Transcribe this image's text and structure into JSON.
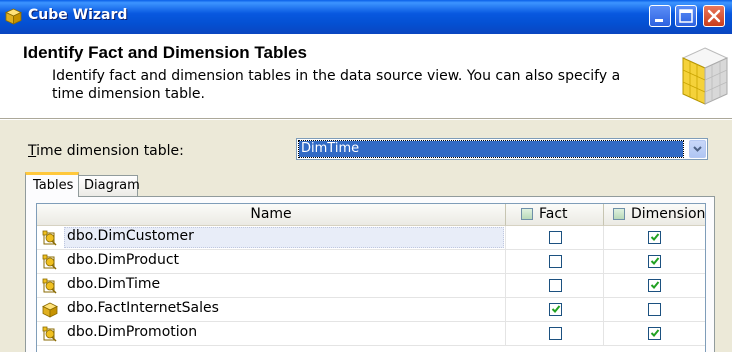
{
  "window": {
    "title": "Cube Wizard"
  },
  "header": {
    "title": "Identify Fact and Dimension Tables",
    "description": "Identify fact and dimension tables in the data source view. You can also specify a time dimension table."
  },
  "time_dimension": {
    "label_prefix": "T",
    "label_rest": "ime dimension table:",
    "selected": "DimTime"
  },
  "tabs": [
    {
      "label": "Tables",
      "active": true
    },
    {
      "label": "Diagram",
      "active": false
    }
  ],
  "grid": {
    "columns": {
      "name": "Name",
      "fact": "Fact",
      "dimension": "Dimension"
    },
    "rows": [
      {
        "name": "dbo.DimCustomer",
        "type": "dimension",
        "fact": false,
        "dimension": true,
        "selected": true
      },
      {
        "name": "dbo.DimProduct",
        "type": "dimension",
        "fact": false,
        "dimension": true,
        "selected": false
      },
      {
        "name": "dbo.DimTime",
        "type": "dimension",
        "fact": false,
        "dimension": true,
        "selected": false
      },
      {
        "name": "dbo.FactInternetSales",
        "type": "fact",
        "fact": true,
        "dimension": false,
        "selected": false
      },
      {
        "name": "dbo.DimPromotion",
        "type": "dimension",
        "fact": false,
        "dimension": true,
        "selected": false
      }
    ]
  },
  "colors": {
    "titlebar": "#0450d2",
    "selection": "#316ac5",
    "check": "#21a121",
    "tab_highlight": "#ffc83c"
  }
}
